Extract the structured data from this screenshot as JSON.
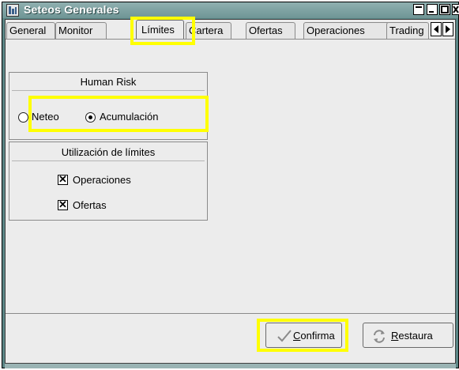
{
  "window": {
    "title": "Seteos Generales"
  },
  "tabs": [
    {
      "label": "General"
    },
    {
      "label": "Monitor"
    },
    {
      "label": "Límites"
    },
    {
      "label": "Cartera"
    },
    {
      "label": "Ofertas"
    },
    {
      "label": "Operaciones"
    },
    {
      "label": "Trading"
    }
  ],
  "active_tab": "Límites",
  "human_risk": {
    "title": "Human Risk",
    "options": [
      {
        "label": "Neteo",
        "selected": false
      },
      {
        "label": "Acumulación",
        "selected": true
      }
    ]
  },
  "utilizacion": {
    "title": "Utilización de límites",
    "items": [
      {
        "label": "Operaciones",
        "checked": true
      },
      {
        "label": "Ofertas",
        "checked": true
      }
    ]
  },
  "buttons": {
    "confirma_mnemonic": "C",
    "confirma_rest": "onfirma",
    "restaura_mnemonic": "R",
    "restaura_rest": "estaura"
  },
  "colors": {
    "highlight": "#ffff00",
    "titlebar": "#7fa3a3",
    "panel_bg": "#ececec"
  }
}
